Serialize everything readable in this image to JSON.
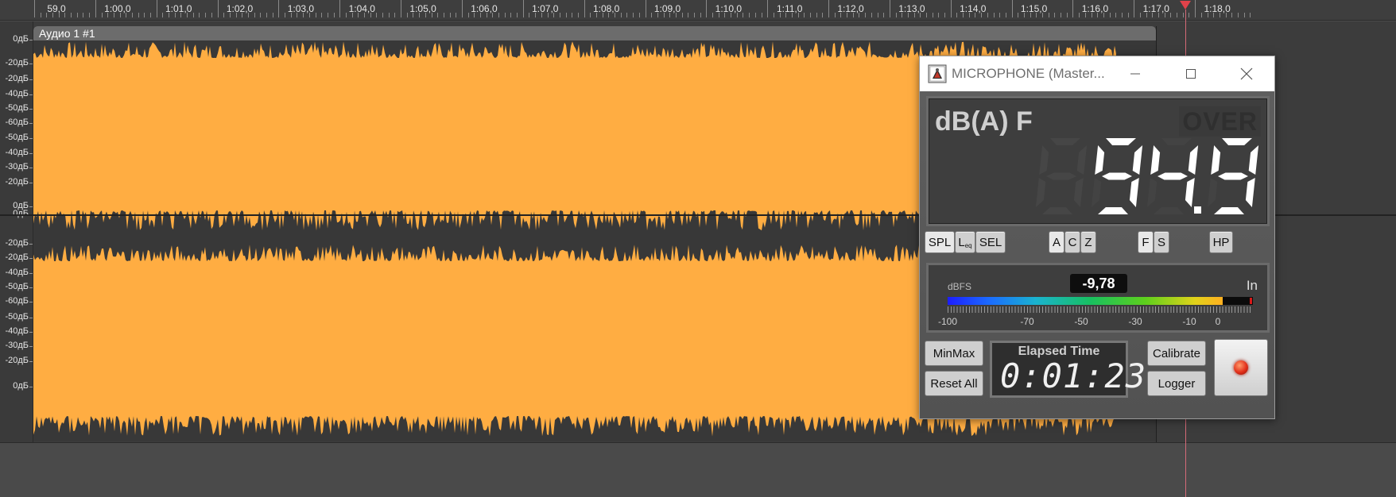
{
  "ruler": {
    "labels": [
      "59,0",
      "1:00,0",
      "1:01,0",
      "1:02,0",
      "1:03,0",
      "1:04,0",
      "1:05,0",
      "1:06,0",
      "1:07,0",
      "1:08,0",
      "1:09,0",
      "1:10,0",
      "1:11,0",
      "1:12,0",
      "1:13,0",
      "1:14,0",
      "1:15,0",
      "1:16,0",
      "1:17,0",
      "1:18,0"
    ],
    "playhead_color": "#e0424a"
  },
  "track": {
    "clip_title": "Аудио 1 #1",
    "wave_color": "#ffad42",
    "channel1_db_labels": [
      "0дБ",
      "-20дБ",
      "-20дБ",
      "-40дБ",
      "-50дБ",
      "-60дБ",
      "-50дБ",
      "-40дБ",
      "-30дБ",
      "-20дБ",
      "0дБ"
    ],
    "channel2_db_labels": [
      "0дБ",
      "-20дБ",
      "-20дБ",
      "-40дБ",
      "-50дБ",
      "-60дБ",
      "-50дБ",
      "-40дБ",
      "-30дБ",
      "-20дБ",
      "0дБ"
    ]
  },
  "meter": {
    "window_title": "MICROPHONE (Master...",
    "weighting_label": "dB(A) F",
    "over_label": "OVER",
    "spl_value": "94.9",
    "mode_buttons": {
      "spl": "SPL",
      "leq_main": "L",
      "leq_sub": "eq",
      "sel": "SEL",
      "a": "A",
      "c": "C",
      "z": "Z",
      "f": "F",
      "s": "S",
      "hp": "HP"
    },
    "dbfs_label": "dBFS",
    "dbfs_value": "-9,78",
    "in_label": "In",
    "level_fraction": 0.9,
    "scale_labels": [
      "-100",
      "-70",
      "-50",
      "-30",
      "-10",
      "0"
    ],
    "minmax_label": "MinMax",
    "reset_label": "Reset All",
    "elapsed_title": "Elapsed Time",
    "elapsed_time": "0:01:23",
    "calibrate_label": "Calibrate",
    "logger_label": "Logger"
  }
}
